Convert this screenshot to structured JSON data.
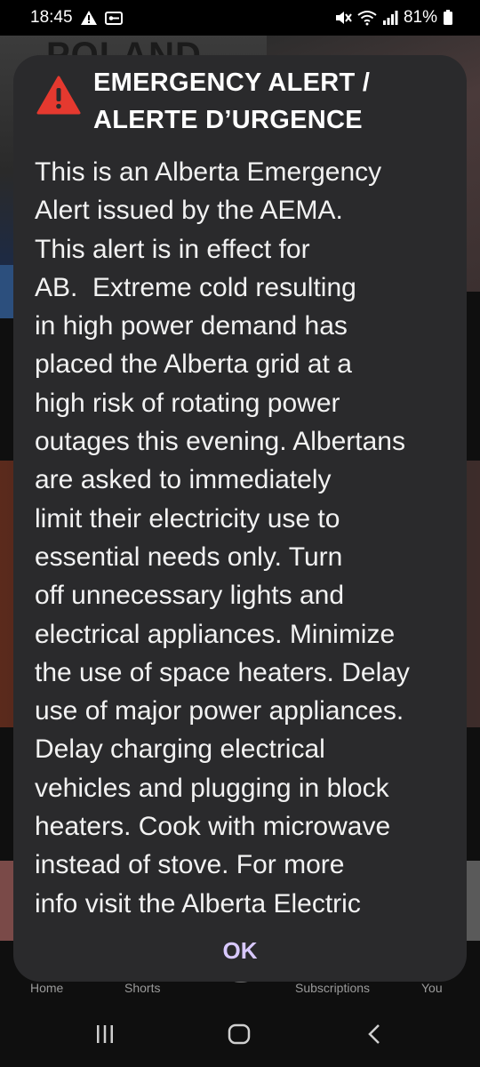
{
  "status_bar": {
    "time": "18:45",
    "battery": "81%",
    "icons": [
      "warning-icon",
      "key-icon",
      "mute-icon",
      "wifi-icon",
      "signal-icon",
      "battery-icon"
    ]
  },
  "background": {
    "thumbnail_text": "POLAND"
  },
  "bottom_nav": {
    "items": [
      "Home",
      "Shorts",
      "Subscriptions",
      "You"
    ]
  },
  "alert": {
    "icon": "warning-triangle-icon",
    "title_lines": [
      "EMERGENCY ALERT /",
      "ALERTE D’URGENCE"
    ],
    "body_lines": [
      "This is an Alberta Emergency",
      "Alert issued by the AEMA.",
      "This alert is in effect for",
      "AB.  Extreme cold resulting",
      "in high power demand has",
      "placed the Alberta grid at a",
      "high risk of rotating power",
      "outages this evening. Albertans",
      "are asked to immediately",
      "limit their electricity use to",
      "essential needs only. Turn",
      "off unnecessary lights and",
      "electrical appliances. Minimize",
      "the use of space heaters. Delay",
      "use of major power appliances.",
      "Delay charging electrical",
      "vehicles and plugging in block",
      "heaters. Cook with microwave",
      "instead of stove. For more",
      "info visit the Alberta Electric"
    ],
    "ok_label": "OK",
    "colors": {
      "dialog_bg": "#2a2a2c",
      "warning_red": "#e5392f",
      "ok_text": "#d8c8ff"
    }
  },
  "system_nav": {
    "buttons": [
      "recents-icon",
      "home-icon",
      "back-icon"
    ]
  }
}
